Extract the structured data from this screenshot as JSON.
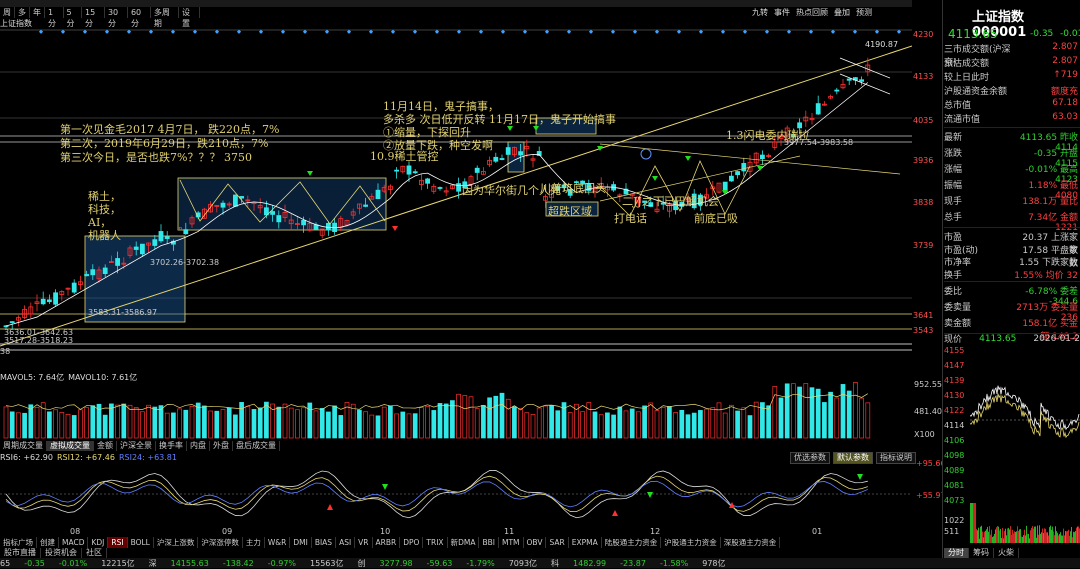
{
  "toolbar": {
    "top_right": [
      "九转",
      "事件",
      "热点回顾",
      "叠加",
      "预测"
    ]
  },
  "periods": [
    {
      "label": "周",
      "active": false
    },
    {
      "label": "多",
      "active": false
    },
    {
      "label": "年",
      "active": false
    },
    {
      "label": "1分",
      "active": false
    },
    {
      "label": "5分",
      "active": false
    },
    {
      "label": "15分",
      "active": false
    },
    {
      "label": "30分",
      "active": false
    },
    {
      "label": "60分",
      "active": false
    },
    {
      "label": "多周期",
      "active": false
    },
    {
      "label": "设置",
      "active": false
    }
  ],
  "chart_title": "上证指数",
  "price_axis": [
    "4230",
    "4133",
    "4035",
    "3936",
    "3838",
    "3739",
    "3641",
    "3543"
  ],
  "high_label": "4190.87",
  "annotations": {
    "left_block": [
      "第一次见金毛2017   4月7日，   跌220点，7%",
      "第二次，2019年6月29日，跌210点，7%",
      "第三次今日，是否也跌7%？？？ 3750"
    ],
    "mid_block": [
      "11月14日，鬼子搞事，",
      "多杀多   次日低开反转   11月17日，鬼子开始搞事",
      "①缩量，下探回升",
      "②放量下跌，种空发啊"
    ],
    "rare_earth": [
      "稀土，",
      "科技，",
      "AI，",
      "机器人"
    ],
    "ten_nine": "10.9稀土管控",
    "huaer": "因为华尔街几个人死",
    "chuanjiang": "川普筑底回头",
    "chaodie": "超跌区域",
    "dadianhua": "打电话",
    "jj": "二JJ之下已巴解机会",
    "qiandi": "前底已吸",
    "fed": "1.3闪电委内瑞拉",
    "box1_label": "3702.26-3702.38",
    "box2_label": "3583.31-3586.97",
    "stripe1": "3636.01-3642.63",
    "stripe2": "3517.28-3518.23",
    "stripe3": "3977.54-3983.58",
    "left_38": "38"
  },
  "volume": {
    "legend_main": "MAVOL5: 7.64亿",
    "legend_ma10": "MAVOL10: 7.61亿",
    "axis_top": "952.55万",
    "axis_mid": "481.40万",
    "axis_unit": "X100",
    "tabs": [
      {
        "label": "周期成交量",
        "active": false
      },
      {
        "label": "虚拟成交量",
        "active": true
      },
      {
        "label": "金额",
        "active": false
      },
      {
        "label": "沪深全景",
        "active": false
      },
      {
        "label": "换手率",
        "active": false
      },
      {
        "label": "内盘",
        "active": false
      },
      {
        "label": "外盘",
        "active": false
      },
      {
        "label": "盘后成交量",
        "active": false
      }
    ]
  },
  "rsi": {
    "rsi6": "RSI6: +62.90",
    "rsi12": "RSI12: +67.46",
    "rsi24": "RSI24: +63.81",
    "buttons": [
      {
        "label": "优选参数",
        "active": false
      },
      {
        "label": "默认参数",
        "active": true
      },
      {
        "label": "指标说明",
        "active": false
      }
    ],
    "axis_top": "+95.66",
    "axis_mid": "+55.97"
  },
  "months": [
    "08",
    "09",
    "10",
    "11",
    "12",
    "01"
  ],
  "indicator_tabs": [
    {
      "label": "指标广场",
      "active": false
    },
    {
      "label": "创建",
      "active": false
    },
    {
      "label": "MACD",
      "active": false
    },
    {
      "label": "KDJ",
      "active": false
    },
    {
      "label": "RSI",
      "active": true
    },
    {
      "label": "BOLL",
      "active": false
    },
    {
      "label": "沪深上涨数",
      "active": false
    },
    {
      "label": "沪深涨停数",
      "active": false
    },
    {
      "label": "主力",
      "active": false
    },
    {
      "label": "W&R",
      "active": false
    },
    {
      "label": "DMI",
      "active": false
    },
    {
      "label": "BIAS",
      "active": false
    },
    {
      "label": "ASI",
      "active": false
    },
    {
      "label": "VR",
      "active": false
    },
    {
      "label": "ARBR",
      "active": false
    },
    {
      "label": "DPO",
      "active": false
    },
    {
      "label": "TRIX",
      "active": false
    },
    {
      "label": "新DMA",
      "active": false
    },
    {
      "label": "BBI",
      "active": false
    },
    {
      "label": "MTM",
      "active": false
    },
    {
      "label": "OBV",
      "active": false
    },
    {
      "label": "SAR",
      "active": false
    },
    {
      "label": "EXPMA",
      "active": false
    },
    {
      "label": "陆股通主力资金",
      "active": false
    },
    {
      "label": "沪股通主力资金",
      "active": false
    },
    {
      "label": "深股通主力资金",
      "active": false
    }
  ],
  "bottom_tabs": [
    "股市直播",
    "投资机会",
    "社区"
  ],
  "status": [
    {
      "text": "65",
      "color": "swhite"
    },
    {
      "text": "-0.35",
      "color": "sgreen"
    },
    {
      "text": "-0.01%",
      "color": "sgreen"
    },
    {
      "text": "12215亿",
      "color": "swhite"
    },
    {
      "text": "深",
      "color": "swhite"
    },
    {
      "text": "14155.63",
      "color": "sgreen"
    },
    {
      "text": "-138.42",
      "color": "sgreen"
    },
    {
      "text": "-0.97%",
      "color": "sgreen"
    },
    {
      "text": "15563亿",
      "color": "swhite"
    },
    {
      "text": "创",
      "color": "swhite"
    },
    {
      "text": "3277.98",
      "color": "sgreen"
    },
    {
      "text": "-59.63",
      "color": "sgreen"
    },
    {
      "text": "-1.79%",
      "color": "sgreen"
    },
    {
      "text": "7093亿",
      "color": "swhite"
    },
    {
      "text": "科",
      "color": "swhite"
    },
    {
      "text": "1482.99",
      "color": "sgreen"
    },
    {
      "text": "-23.87",
      "color": "sgreen"
    },
    {
      "text": "-1.58%",
      "color": "sgreen"
    },
    {
      "text": "978亿",
      "color": "swhite"
    }
  ],
  "quote": {
    "title": "上证指数 000001",
    "price": "4113.65",
    "change": "-0.35",
    "pct": "-0.01",
    "rows1": [
      {
        "k": "三市成交额(沪深京)",
        "v": "2.807",
        "c": "sred"
      },
      {
        "k": "预估成交额",
        "v": "2.807",
        "c": "sred"
      },
      {
        "k": "较上日此时",
        "v": "↑719",
        "c": "sred"
      },
      {
        "k": "沪股通资金余额",
        "v": "额度充",
        "c": "sred"
      },
      {
        "k": "总市值",
        "v": "67.18",
        "c": "sred"
      },
      {
        "k": "流通市值",
        "v": "63.03",
        "c": "sred"
      }
    ],
    "rows2": [
      {
        "k": "最新",
        "v": "4113.65 昨收 4114",
        "c": "sgreen"
      },
      {
        "k": "涨跌",
        "v": "-0.35 开盘 4115",
        "c": "sgreen"
      },
      {
        "k": "涨幅",
        "v": "-0.01% 最高 4123",
        "c": "sgreen"
      },
      {
        "k": "振幅",
        "v": "1.18% 最低 4080",
        "c": "sred"
      },
      {
        "k": "现手",
        "v": "138.1万 量比",
        "c": "sred"
      },
      {
        "k": "总手",
        "v": "7.34亿 金额 1221",
        "c": "sred"
      }
    ],
    "rows3": [
      {
        "k": "市盈",
        "v": "20.37 上涨家数",
        "c": "swhite"
      },
      {
        "k": "市盈(动)",
        "v": "17.58 平盘家数",
        "c": "swhite"
      },
      {
        "k": "市净率",
        "v": "1.55 下跌家数",
        "c": "swhite"
      },
      {
        "k": "换手",
        "v": "1.55% 均价 32",
        "c": "sred"
      }
    ],
    "rows4": [
      {
        "k": "委比",
        "v": "-6.78% 委差 -344.6",
        "c": "sgreen"
      },
      {
        "k": "委卖量",
        "v": "2713万 委买量 236",
        "c": "sred"
      },
      {
        "k": "卖金额",
        "v": "158.1亿 买金额 148.2",
        "c": "sred"
      }
    ],
    "mini_label": "现价",
    "mini_price": "4113.65",
    "mini_date": "2026-01-2",
    "mini_ticks": [
      "4155",
      "4147",
      "4139",
      "4130",
      "4122",
      "4114",
      "4106",
      "4098",
      "4089",
      "4081",
      "4073",
      "1022",
      "511"
    ],
    "mini_tabs": [
      {
        "label": "分时",
        "active": true
      },
      {
        "label": "筹码",
        "active": false
      },
      {
        "label": "火柴",
        "active": false
      }
    ]
  },
  "colors": {
    "up": "#ff3030",
    "down": "#30e8e8",
    "ma": "#e8d870",
    "box": "#1a5aa0"
  }
}
